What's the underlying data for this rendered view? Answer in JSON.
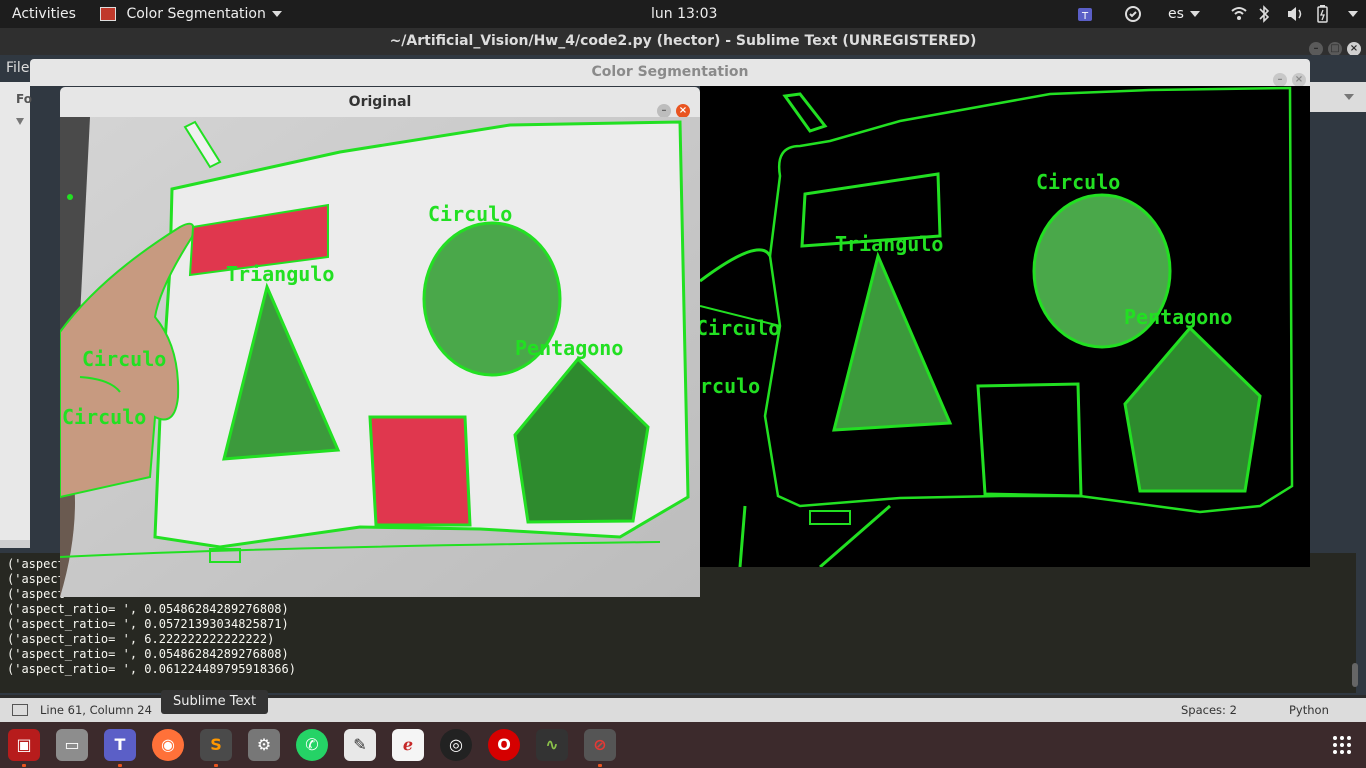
{
  "topbar": {
    "activities": "Activities",
    "app_menu": "Color Segmentation",
    "clock": "lun 13:03",
    "language": "es"
  },
  "sublime": {
    "title": "~/Artificial_Vision/Hw_4/code2.py (hector) - Sublime Text (UNREGISTERED)",
    "menu_file": "File",
    "console_lines": [
      "('aspect_ratio= ', 0.05486284289276808)",
      "('aspect_ratio= ', 0.05721393034825871)",
      "('aspect_ratio= ', 6.222222222222222)",
      "('aspect_ratio= ', 0.05486284289276808)",
      "('aspect_ratio= ', 0.061224489795918366)"
    ],
    "console_partial": "('aspect",
    "status_position": "Line 61, Column 24",
    "status_spaces": "Spaces: 2",
    "status_syntax": "Python",
    "tooltip": "Sublime Text"
  },
  "seg_window": {
    "title": "Color Segmentation",
    "labels": {
      "circulo1": "Circulo",
      "triangulo": "Triangulo",
      "pentagono": "Pentagono",
      "circulo2": "Circulo",
      "circulo3": "rculo"
    }
  },
  "orig_window": {
    "title": "Original",
    "labels": {
      "circulo1": "Circulo",
      "triangulo": "Triangulo",
      "pentagono": "Pentagono",
      "circulo2": "Circulo",
      "circulo3": "Circulo"
    }
  },
  "dock": {
    "icons": [
      "terminal-icon",
      "files-icon",
      "teams-icon",
      "firefox-icon",
      "sublime-icon",
      "settings-icon",
      "whatsapp-icon",
      "text-editor-icon",
      "document-viewer-icon",
      "obs-icon",
      "opera-icon",
      "system-monitor-icon",
      "color-segmentation-icon"
    ],
    "apps_grid": "show-applications-icon"
  },
  "colors": {
    "contour": "#22e022",
    "ubuntu_orange": "#e95420",
    "shape_green": "#3c9a3c",
    "shape_red": "#e0374e"
  }
}
